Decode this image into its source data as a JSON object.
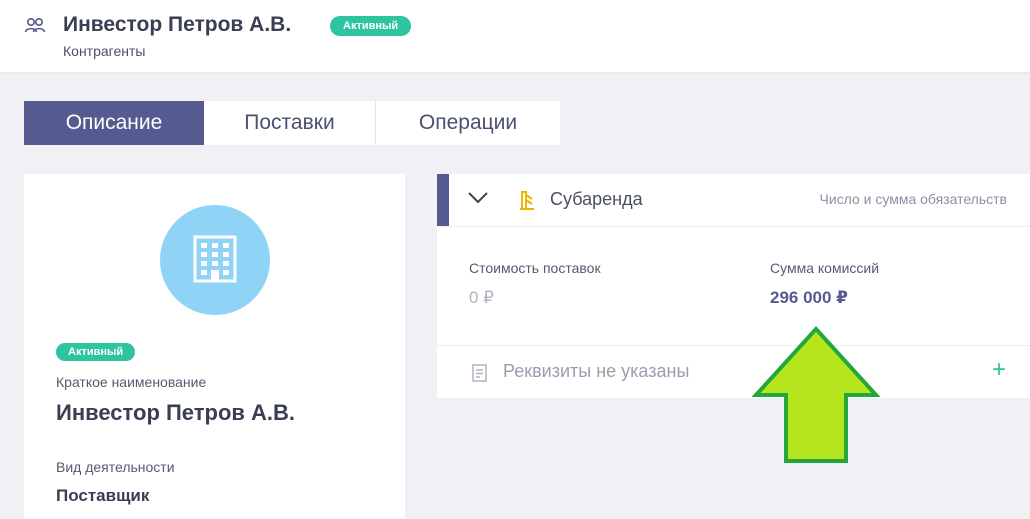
{
  "header": {
    "title": "Инвестор Петров А.В.",
    "status": "Активный",
    "breadcrumb": "Контрагенты",
    "icon": "users-icon"
  },
  "tabs": [
    {
      "label": "Описание",
      "active": true
    },
    {
      "label": "Поставки",
      "active": false
    },
    {
      "label": "Операции",
      "active": false
    }
  ],
  "profile": {
    "avatar_icon": "building-icon",
    "status": "Активный",
    "short_name_label": "Краткое наименование",
    "short_name": "Инвестор Петров А.В.",
    "activity_label": "Вид деятельности",
    "activity": "Поставщик"
  },
  "subrent": {
    "title": "Субаренда",
    "hint": "Число и сумма обязательств",
    "supply_cost_label": "Стоимость поставок",
    "supply_cost": "0 ₽",
    "commission_label": "Сумма комиссий",
    "commission": "296 000 ₽"
  },
  "requisites": {
    "text": "Реквизиты не указаны",
    "add_icon": "plus-icon"
  },
  "colors": {
    "accent": "#555a90",
    "status_green": "#2ec4a0",
    "avatar_blue": "#8fd4f7",
    "arrow_green": "#b5e61d"
  }
}
